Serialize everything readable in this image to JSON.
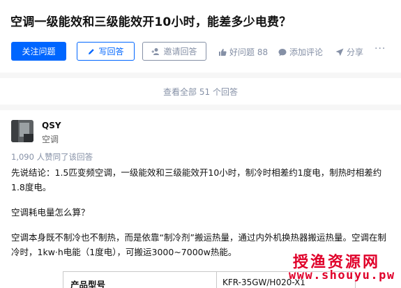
{
  "question": {
    "title": "空调一级能效和三级能效开10小时，能差多少电费？",
    "follow_label": "关注问题",
    "write_label": "写回答",
    "invite_label": "邀请回答",
    "good_label": "好问题 88",
    "comment_label": "添加评论",
    "share_label": "分享",
    "more_label": "···"
  },
  "view_all": "查看全部 51 个回答",
  "answer": {
    "author": "QSY",
    "bio": "空调",
    "upvote_info": "1,090 人赞同了该回答",
    "p1": "先说结论：1.5匹变频空调，一级能效和三级能效开10小时，制冷时相差约1度电，制热时相差约1.8度电。",
    "p2": "空调耗电量怎么算？",
    "p3": "空调本身既不制冷也不制热，而是依靠“制冷剂”搬运热量，通过内外机换热器搬运热量。空调在制冷时，1kw·h电能（1度电），可搬运3000~7000w热能。",
    "table_header_1": "产品型号",
    "table_header_2": "KFR-35GW/H020-X1"
  },
  "watermark": {
    "cn": "授渔资源网",
    "en": "www.shouyu.pw"
  },
  "colors": {
    "primary": "#0066ff",
    "muted": "#8590a6",
    "watermark": "#e0002a"
  }
}
